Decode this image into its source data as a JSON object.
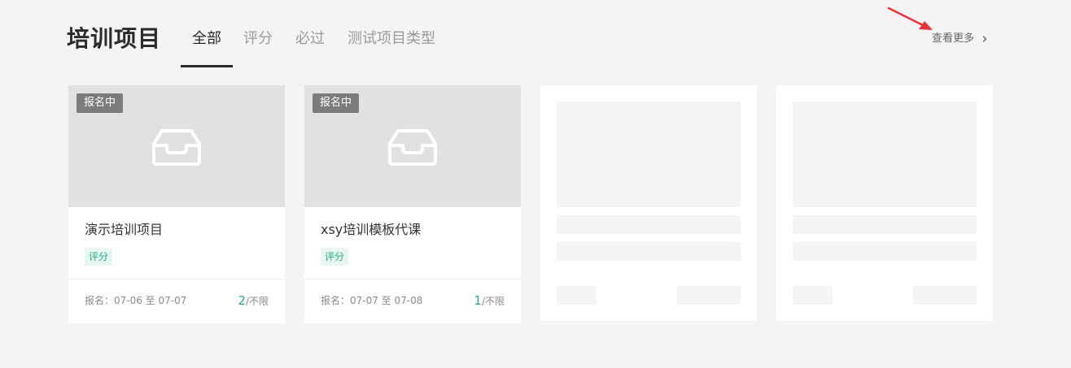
{
  "header": {
    "title": "培训项目",
    "tabs": [
      {
        "label": "全部",
        "active": true
      },
      {
        "label": "评分",
        "active": false
      },
      {
        "label": "必过",
        "active": false
      },
      {
        "label": "测试项目类型",
        "active": false
      }
    ],
    "view_more_label": "查看更多"
  },
  "cards": [
    {
      "status_badge": "报名中",
      "title": "演示培训项目",
      "tag": "评分",
      "enroll_label": "报名：07-06 至 07-07",
      "enroll_count": "2",
      "enroll_limit": "/不限",
      "cover_icon": "inbox-icon"
    },
    {
      "status_badge": "报名中",
      "title": "xsy培训模板代课",
      "tag": "评分",
      "enroll_label": "报名：07-07 至 07-08",
      "enroll_count": "1",
      "enroll_limit": "/不限",
      "cover_icon": "inbox-icon"
    }
  ],
  "colors": {
    "background": "#f4f4f5",
    "accent_green": "#21b07a",
    "badge_gray": "#7c7c7c",
    "annotation_red": "#e8333a"
  }
}
